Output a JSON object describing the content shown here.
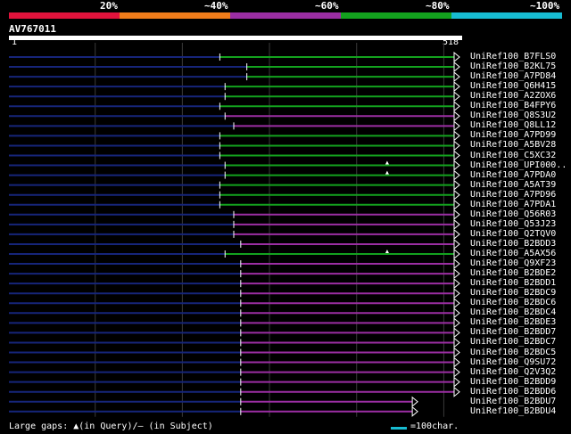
{
  "legend": {
    "labels": [
      "20%",
      "~40%",
      "~60%",
      "~80%",
      "~100%"
    ],
    "colors": [
      "#e0133c",
      "#f07c1a",
      "#9b2ea3",
      "#13a21e",
      "#17bcd2"
    ]
  },
  "query": {
    "id": "AV767011",
    "start_label": "1",
    "end_label": "518",
    "length": 518
  },
  "hits": [
    {
      "name": "UniRef100_B7FLS0",
      "start": 243,
      "color": "green",
      "gap": null
    },
    {
      "name": "UniRef100_B2KL75",
      "start": 274,
      "color": "green",
      "gap": null
    },
    {
      "name": "UniRef100_A7PD84",
      "start": 274,
      "color": "green",
      "gap": null
    },
    {
      "name": "UniRef100_Q6H415",
      "start": 249,
      "color": "green",
      "gap": null
    },
    {
      "name": "UniRef100_A2ZOX6",
      "start": 249,
      "color": "green",
      "gap": null
    },
    {
      "name": "UniRef100_B4FPY6",
      "start": 243,
      "color": "green",
      "gap": null
    },
    {
      "name": "UniRef100_Q8S3U2",
      "start": 249,
      "color": "purple",
      "gap": null
    },
    {
      "name": "UniRef100_Q8LL12",
      "start": 259,
      "color": "purple",
      "gap": null
    },
    {
      "name": "UniRef100_A7PD99",
      "start": 243,
      "color": "green",
      "gap": null
    },
    {
      "name": "UniRef100_A5BV28",
      "start": 243,
      "color": "green",
      "gap": null
    },
    {
      "name": "UniRef100_C5XC32",
      "start": 243,
      "color": "green",
      "gap": null
    },
    {
      "name": "UniRef100_UPI000..",
      "start": 249,
      "color": "green",
      "gap": "query"
    },
    {
      "name": "UniRef100_A7PDA0",
      "start": 249,
      "color": "green",
      "gap": "query"
    },
    {
      "name": "UniRef100_A5AT39",
      "start": 243,
      "color": "green",
      "gap": null
    },
    {
      "name": "UniRef100_A7PD96",
      "start": 243,
      "color": "green",
      "gap": null
    },
    {
      "name": "UniRef100_A7PDA1",
      "start": 243,
      "color": "green",
      "gap": null
    },
    {
      "name": "UniRef100_Q56R03",
      "start": 259,
      "color": "purple",
      "gap": null
    },
    {
      "name": "UniRef100_Q53J23",
      "start": 259,
      "color": "purple",
      "gap": null
    },
    {
      "name": "UniRef100_Q2TQV0",
      "start": 259,
      "color": "purple",
      "gap": null
    },
    {
      "name": "UniRef100_B2BDD3",
      "start": 267,
      "color": "purple",
      "gap": null
    },
    {
      "name": "UniRef100_A5AX56",
      "start": 249,
      "color": "green",
      "gap": "query"
    },
    {
      "name": "UniRef100_Q9XF23",
      "start": 267,
      "color": "purple",
      "gap": null
    },
    {
      "name": "UniRef100_B2BDE2",
      "start": 267,
      "color": "purple",
      "gap": null
    },
    {
      "name": "UniRef100_B2BDD1",
      "start": 267,
      "color": "purple",
      "gap": null
    },
    {
      "name": "UniRef100_B2BDC9",
      "start": 267,
      "color": "purple",
      "gap": null
    },
    {
      "name": "UniRef100_B2BDC6",
      "start": 267,
      "color": "purple",
      "gap": null
    },
    {
      "name": "UniRef100_B2BDC4",
      "start": 267,
      "color": "purple",
      "gap": null
    },
    {
      "name": "UniRef100_B2BDE3",
      "start": 267,
      "color": "purple",
      "gap": null
    },
    {
      "name": "UniRef100_B2BDD7",
      "start": 267,
      "color": "purple",
      "gap": null
    },
    {
      "name": "UniRef100_B2BDC7",
      "start": 267,
      "color": "purple",
      "gap": null
    },
    {
      "name": "UniRef100_B2BDC5",
      "start": 267,
      "color": "purple",
      "gap": null
    },
    {
      "name": "UniRef100_Q9SU72",
      "start": 267,
      "color": "purple",
      "gap": null
    },
    {
      "name": "UniRef100_Q2V3Q2",
      "start": 267,
      "color": "purple",
      "gap": null
    },
    {
      "name": "UniRef100_B2BDD9",
      "start": 267,
      "color": "purple",
      "gap": null
    },
    {
      "name": "UniRef100_B2BDD6",
      "start": 267,
      "color": "purple",
      "gap": null
    },
    {
      "name": "UniRef100_B2BDU7",
      "start": 267,
      "color": "purple",
      "gap": null,
      "end": 470
    },
    {
      "name": "UniRef100_B2BDU4",
      "start": 267,
      "color": "purple",
      "gap": null,
      "end": 470
    }
  ],
  "footer": {
    "gaps_label": "Large gaps: ▲(in Query)/– (in Subject)",
    "scale_label": "=100char."
  }
}
